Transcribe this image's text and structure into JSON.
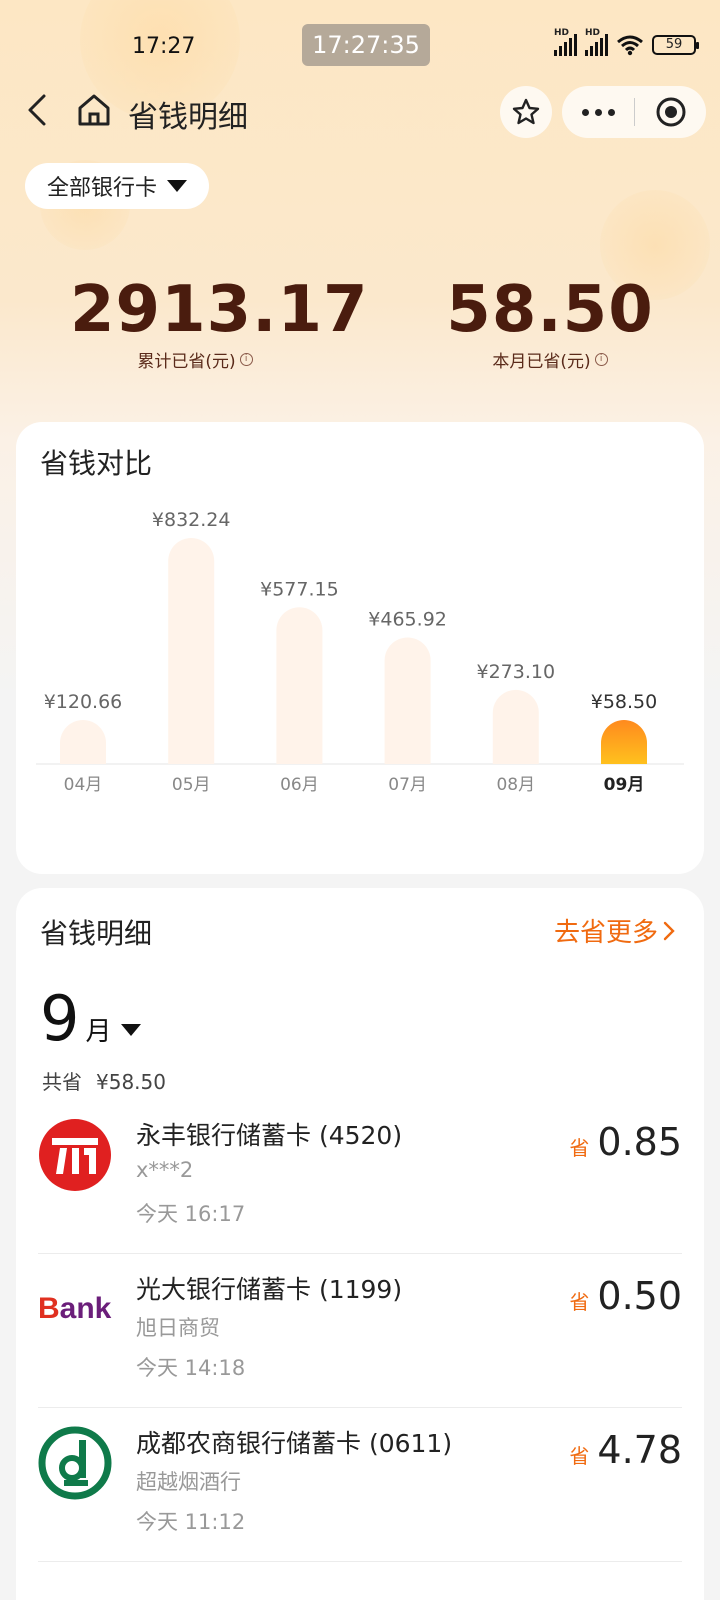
{
  "status_bar": {
    "time": "17:27",
    "clock_badge": "17:27:35",
    "signal1_label": "HD",
    "signal2_label": "HD",
    "battery": "59"
  },
  "nav": {
    "title": "省钱明细"
  },
  "filter": {
    "label": "全部银行卡"
  },
  "summary": {
    "total_value": "2913.17",
    "total_label": "累计已省(元)",
    "month_value": "58.50",
    "month_label": "本月已省(元)",
    "info_glyph": "i"
  },
  "chart_card": {
    "title": "省钱对比"
  },
  "chart_data": {
    "type": "bar",
    "categories": [
      "04月",
      "05月",
      "06月",
      "07月",
      "08月",
      "09月"
    ],
    "values": [
      120.66,
      832.24,
      577.15,
      465.92,
      273.1,
      58.5
    ],
    "value_labels": [
      "¥120.66",
      "¥832.24",
      "¥577.15",
      "¥465.92",
      "¥273.10",
      "¥58.50"
    ],
    "highlight_index": 5,
    "colors": {
      "bar": "#fff3ea",
      "highlight_top": "#ff8a1e",
      "highlight_bottom": "#ffc11e"
    },
    "grid": false
  },
  "detail": {
    "title": "省钱明细",
    "go_more": "去省更多",
    "month_num": "9",
    "month_unit": "月",
    "total_label": "共省",
    "total_value": "¥58.50",
    "save_tag": "省",
    "items": [
      {
        "name": "永丰银行储蓄卡 (4520)",
        "merchant": "x***2",
        "time": "今天 16:17",
        "amount": "0.85",
        "logo": "yongfeng-logo"
      },
      {
        "name": "光大银行储蓄卡 (1199)",
        "merchant": "旭日商贸",
        "time": "今天 14:18",
        "amount": "0.50",
        "logo": "bank-logo",
        "logo_text": {
          "b": "B",
          "rest": "ank"
        }
      },
      {
        "name": "成都农商银行储蓄卡 (0611)",
        "merchant": "超越烟酒行",
        "time": "今天 11:12",
        "amount": "4.78",
        "logo": "chengdu-rural-logo"
      }
    ]
  },
  "colors": {
    "accent": "#f06a10",
    "summary_text": "#4a1c0e"
  }
}
